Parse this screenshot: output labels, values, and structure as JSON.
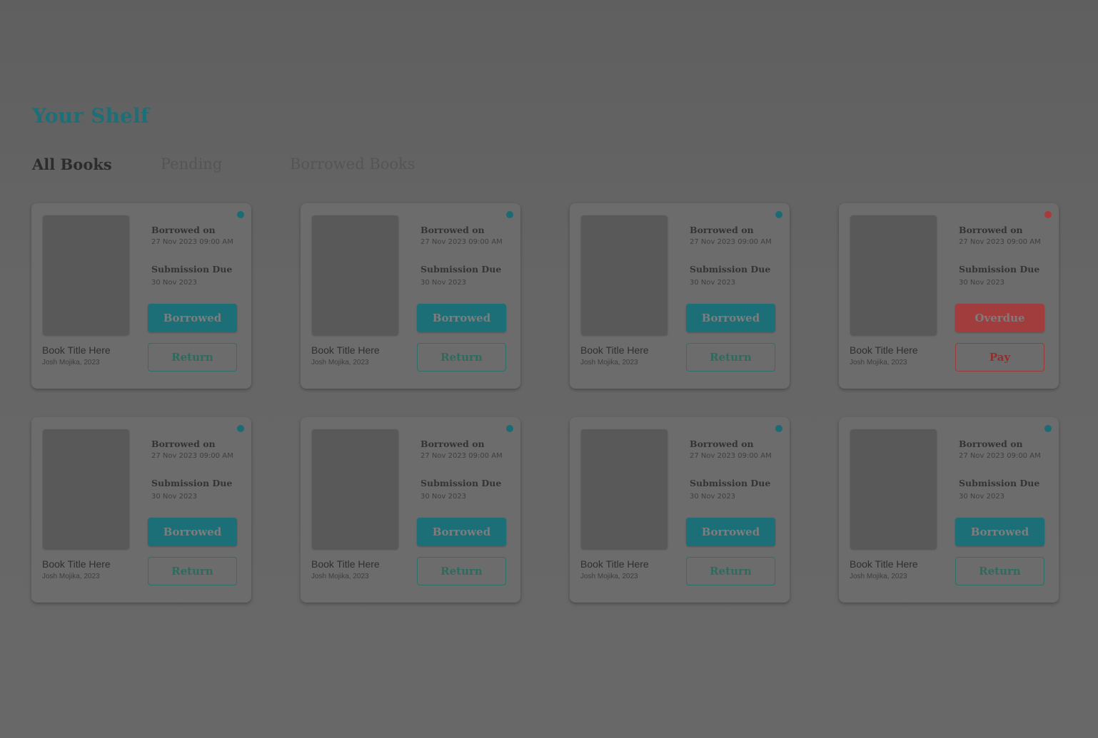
{
  "page": {
    "title": "Your Shelf",
    "tabs": [
      {
        "label": "All Books",
        "active": true
      },
      {
        "label": "Pending",
        "active": false
      },
      {
        "label": "Borrowed Books",
        "active": false
      }
    ]
  },
  "colors": {
    "accent_teal": "#1d6f77",
    "overdue_red": "#a23d3d",
    "dot_teal": "#1a6b73",
    "dot_red": "#a83a3a",
    "return_border": "#2f6f68",
    "return_text": "#2e6a5e",
    "pay_border": "#9b3a3a",
    "pay_text": "#8f2f2f"
  },
  "cards": [
    {
      "borrowed_label": "Borrowed on",
      "borrowed_date": "27 Nov 2023 09:00 AM",
      "due_label": "Submission Due",
      "due_date": "30 Nov 2023",
      "status": "Borrowed",
      "action": "Return",
      "book_title": "Book Title Here",
      "book_meta": "Josh Mojika, 2023",
      "state": "borrowed"
    },
    {
      "borrowed_label": "Borrowed on",
      "borrowed_date": "27 Nov 2023 09:00 AM",
      "due_label": "Submission Due",
      "due_date": "30 Nov 2023",
      "status": "Borrowed",
      "action": "Return",
      "book_title": "Book Title Here",
      "book_meta": "Josh Mojika, 2023",
      "state": "borrowed"
    },
    {
      "borrowed_label": "Borrowed on",
      "borrowed_date": "27 Nov 2023 09:00 AM",
      "due_label": "Submission Due",
      "due_date": "30 Nov 2023",
      "status": "Borrowed",
      "action": "Return",
      "book_title": "Book Title Here",
      "book_meta": "Josh Mojika, 2023",
      "state": "borrowed"
    },
    {
      "borrowed_label": "Borrowed on",
      "borrowed_date": "27 Nov 2023 09:00 AM",
      "due_label": "Submission Due",
      "due_date": "30 Nov 2023",
      "status": "Overdue",
      "action": "Pay",
      "book_title": "Book Title Here",
      "book_meta": "Josh Mojika, 2023",
      "state": "overdue"
    },
    {
      "borrowed_label": "Borrowed on",
      "borrowed_date": "27 Nov 2023 09:00 AM",
      "due_label": "Submission Due",
      "due_date": "30 Nov 2023",
      "status": "Borrowed",
      "action": "Return",
      "book_title": "Book Title Here",
      "book_meta": "Josh Mojika, 2023",
      "state": "borrowed"
    },
    {
      "borrowed_label": "Borrowed on",
      "borrowed_date": "27 Nov 2023 09:00 AM",
      "due_label": "Submission Due",
      "due_date": "30 Nov 2023",
      "status": "Borrowed",
      "action": "Return",
      "book_title": "Book Title Here",
      "book_meta": "Josh Mojika, 2023",
      "state": "borrowed"
    },
    {
      "borrowed_label": "Borrowed on",
      "borrowed_date": "27 Nov 2023 09:00 AM",
      "due_label": "Submission Due",
      "due_date": "30 Nov 2023",
      "status": "Borrowed",
      "action": "Return",
      "book_title": "Book Title Here",
      "book_meta": "Josh Mojika, 2023",
      "state": "borrowed"
    },
    {
      "borrowed_label": "Borrowed on",
      "borrowed_date": "27 Nov 2023 09:00 AM",
      "due_label": "Submission Due",
      "due_date": "30 Nov 2023",
      "status": "Borrowed",
      "action": "Return",
      "book_title": "Book Title Here",
      "book_meta": "Josh Mojika, 2023",
      "state": "borrowed"
    }
  ]
}
